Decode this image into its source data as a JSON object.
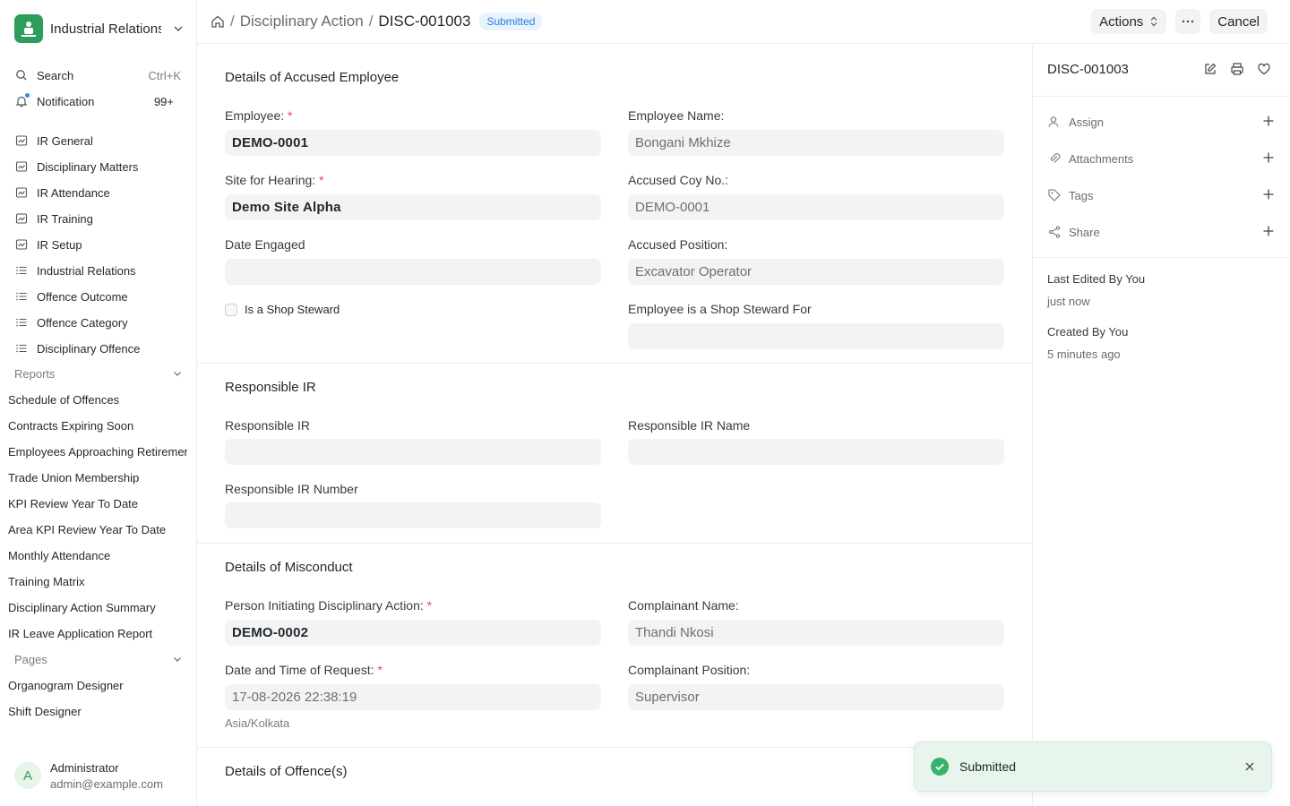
{
  "app": {
    "name": "Industrial Relations"
  },
  "sidebar": {
    "search_label": "Search",
    "search_shortcut": "Ctrl+K",
    "notification_label": "Notification",
    "notification_count": "99+",
    "workspaces": [
      {
        "label": "IR General",
        "icon": "chart-icon"
      },
      {
        "label": "Disciplinary Matters",
        "icon": "chart-icon"
      },
      {
        "label": "IR Attendance",
        "icon": "chart-icon"
      },
      {
        "label": "IR Training",
        "icon": "chart-icon"
      },
      {
        "label": "IR Setup",
        "icon": "chart-icon"
      },
      {
        "label": "Industrial Relations",
        "icon": "list-icon"
      },
      {
        "label": "Offence Outcome",
        "icon": "list-icon"
      },
      {
        "label": "Offence Category",
        "icon": "list-icon"
      },
      {
        "label": "Disciplinary Offence",
        "icon": "list-icon"
      }
    ],
    "reports_label": "Reports",
    "reports": [
      "Schedule of Offences",
      "Contracts Expiring Soon",
      "Employees Approaching Retirement",
      "Trade Union Membership",
      "KPI Review Year To Date",
      "Area KPI Review Year To Date",
      "Monthly Attendance",
      "Training Matrix",
      "Disciplinary Action Summary",
      "IR Leave Application Report"
    ],
    "pages_label": "Pages",
    "pages": [
      "Organogram Designer",
      "Shift Designer"
    ],
    "user": {
      "initial": "A",
      "name": "Administrator",
      "email": "admin@example.com"
    }
  },
  "topbar": {
    "breadcrumb_parent": "Disciplinary Action",
    "breadcrumb_current": "DISC-001003",
    "status_badge": "Submitted",
    "actions_label": "Actions",
    "cancel_label": "Cancel"
  },
  "form": {
    "sec_accused": "Details of Accused Employee",
    "employee_label": "Employee:",
    "employee_value": "DEMO-0001",
    "employee_name_label": "Employee Name:",
    "employee_name_value": "Bongani Mkhize",
    "site_label": "Site for Hearing:",
    "site_value": "Demo Site Alpha",
    "coy_label": "Accused Coy No.:",
    "coy_value": "DEMO-0001",
    "date_engaged_label": "Date Engaged",
    "date_engaged_value": "",
    "position_label": "Accused Position:",
    "position_value": "Excavator Operator",
    "shop_steward_label": "Is a Shop Steward",
    "shop_steward_for_label": "Employee is a Shop Steward For",
    "shop_steward_for_value": "",
    "sec_responsible": "Responsible IR",
    "resp_ir_label": "Responsible IR",
    "resp_ir_value": "",
    "resp_ir_name_label": "Responsible IR Name",
    "resp_ir_name_value": "",
    "resp_ir_number_label": "Responsible IR Number",
    "resp_ir_number_value": "",
    "sec_misconduct": "Details of Misconduct",
    "initiator_label": "Person Initiating Disciplinary Action:",
    "initiator_value": "DEMO-0002",
    "complainant_name_label": "Complainant Name:",
    "complainant_name_value": "Thandi Nkosi",
    "request_dt_label": "Date and Time of Request:",
    "request_dt_value": "17-08-2026 22:38:19",
    "timezone_hint": "Asia/Kolkata",
    "complainant_pos_label": "Complainant Position:",
    "complainant_pos_value": "Supervisor",
    "sec_offences": "Details of Offence(s)",
    "required_mark": "*"
  },
  "rpanel": {
    "title": "DISC-001003",
    "assign_label": "Assign",
    "attachments_label": "Attachments",
    "tags_label": "Tags",
    "share_label": "Share",
    "last_edited_label": "Last Edited By You",
    "last_edited_time": "just now",
    "created_label": "Created By You",
    "created_time": "5 minutes ago"
  },
  "toast": {
    "message": "Submitted"
  },
  "colors": {
    "accent": "#2490ef",
    "brand": "#2e9d5b",
    "badge_bg": "#e8f3fd",
    "badge_text": "#2b7fd5",
    "toast_bg": "#e7f5ec",
    "required": "#e24c4c"
  }
}
